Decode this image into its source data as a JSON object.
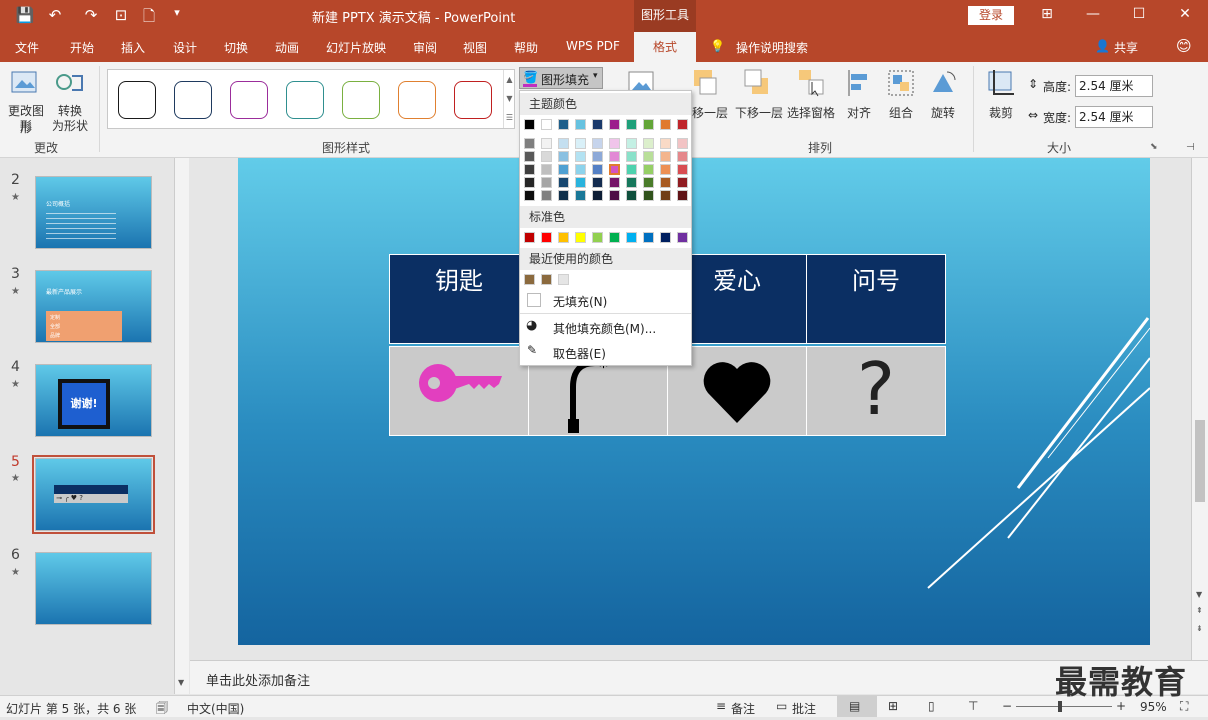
{
  "titlebar": {
    "title": "新建 PPTX 演示文稿  -  PowerPoint",
    "drawing_tools": "图形工具",
    "login": "登录"
  },
  "tabs": {
    "file": "文件",
    "home": "开始",
    "insert": "插入",
    "design": "设计",
    "transitions": "切换",
    "animations": "动画",
    "slideshow": "幻灯片放映",
    "review": "审阅",
    "view": "视图",
    "help": "帮助",
    "wpspdf": "WPS PDF",
    "format": "格式",
    "tellme": "操作说明搜索",
    "share": "共享"
  },
  "ribbon": {
    "edit_shape": "更改图形",
    "edit_shape_line2": "形",
    "convert": "转换",
    "convert_line2": "为形状",
    "group_change": "更改",
    "group_styles": "图形样式",
    "shape_fill": "图形填充",
    "bring_forward": "移一层",
    "send_backward": "下移一层",
    "selection_pane": "选择窗格",
    "align": "对齐",
    "group": "组合",
    "rotate": "旋转",
    "group_arrange": "排列",
    "crop": "裁剪",
    "height_label": "高度:",
    "height_value": "2.54 厘米",
    "width_label": "宽度:",
    "width_value": "2.54 厘米",
    "group_size": "大小",
    "style_colors": [
      "#1a1a1a",
      "#1f3a5f",
      "#9b2d9b",
      "#2f8f8f",
      "#7ab040",
      "#e08030",
      "#c02020"
    ]
  },
  "dropdown": {
    "theme_colors": "主题颜色",
    "standard_colors": "标准色",
    "recent_colors": "最近使用的颜色",
    "no_fill": "无填充(N)",
    "more_colors": "其他填充颜色(M)...",
    "eyedropper": "取色器(E)",
    "theme_top": [
      "#000000",
      "#ffffff",
      "#1f5f8b",
      "#66c2e0",
      "#1b3a6b",
      "#9c1c8c",
      "#1fa07a",
      "#63a538",
      "#e07a2e",
      "#c0262c"
    ],
    "theme_shades": [
      [
        "#7f7f7f",
        "#595959",
        "#3f3f3f",
        "#262626",
        "#0d0d0d"
      ],
      [
        "#f2f2f2",
        "#d9d9d9",
        "#bfbfbf",
        "#a6a6a6",
        "#808080"
      ],
      [
        "#c4dff0",
        "#8ac0e1",
        "#4fa0d2",
        "#174770",
        "#0f2f4a"
      ],
      [
        "#d9f0f8",
        "#b3e2f2",
        "#8dd3ec",
        "#2ab3dd",
        "#1a7898"
      ],
      [
        "#c6d4ec",
        "#8da9d8",
        "#5480c5",
        "#142c50",
        "#0d1d35"
      ],
      [
        "#f0c4ea",
        "#e289d5",
        "#d453c0",
        "#761569",
        "#4e0e46"
      ],
      [
        "#c4f0e4",
        "#8ae1c9",
        "#4fd2ae",
        "#17785c",
        "#0f503d"
      ],
      [
        "#dcefcc",
        "#b9df99",
        "#96cf66",
        "#4a7c2a",
        "#31531c"
      ],
      [
        "#f9dac6",
        "#f3b58d",
        "#ed9054",
        "#a85b22",
        "#703d17"
      ],
      [
        "#f2c3c4",
        "#e5888b",
        "#d84d52",
        "#901c21",
        "#601316"
      ]
    ],
    "standard": [
      "#c00000",
      "#ff0000",
      "#ffc000",
      "#ffff00",
      "#92d050",
      "#00b050",
      "#00b0f0",
      "#0070c0",
      "#002060",
      "#7030a0"
    ],
    "recent": [
      "#8b6a3e",
      "#8b6a3e",
      "#e5e5e5"
    ]
  },
  "slides": [
    {
      "num": "2",
      "star": "★",
      "title": "公司概括"
    },
    {
      "num": "3",
      "star": "★",
      "title": "最新产品展示"
    },
    {
      "num": "4",
      "star": "★",
      "title": "谢谢!"
    },
    {
      "num": "5",
      "star": "★",
      "title": ""
    },
    {
      "num": "6",
      "star": "★",
      "title": ""
    }
  ],
  "slide_thumb3": {
    "r1": "定制",
    "r2": "全部",
    "r3": "品牌"
  },
  "table": {
    "headers": [
      "钥匙",
      "",
      "爱心",
      "问号"
    ],
    "question_mark": "?"
  },
  "notes_placeholder": "单击此处添加备注",
  "status": {
    "slide_info": "幻灯片 第 5 张，共 6 张",
    "language": "中文(中国)",
    "notes": "备注",
    "comments": "批注",
    "zoom": "95%"
  },
  "watermark": "最需教育"
}
